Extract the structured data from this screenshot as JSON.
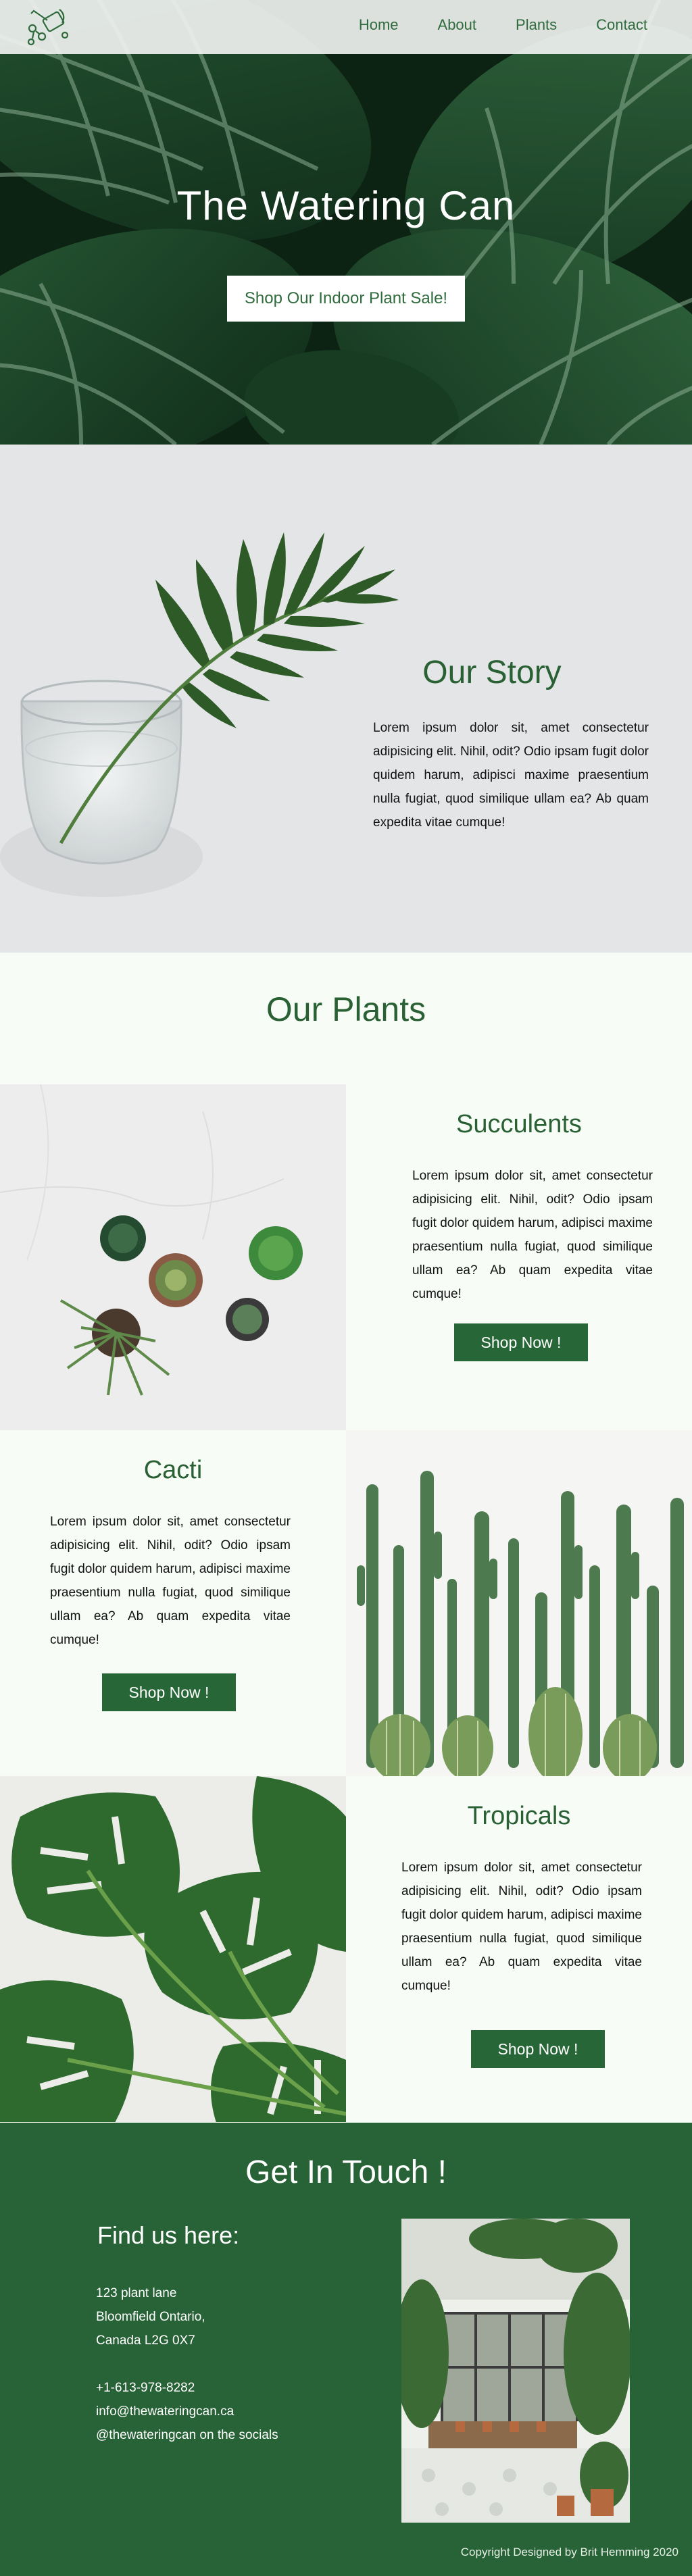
{
  "nav": {
    "logo_icon": "watering-can-icon",
    "links": [
      "Home",
      "About",
      "Plants",
      "Contact"
    ]
  },
  "hero": {
    "title": "The Watering Can",
    "button": "Shop Our Indoor Plant Sale!"
  },
  "story": {
    "title": "Our Story",
    "text": "Lorem ipsum dolor sit, amet consectetur adipisicing elit. Nihil, odit? Odio ipsam fugit dolor quidem harum, adipisci maxime praesentium nulla fugiat, quod similique ullam ea? Ab quam expedita vitae cumque!"
  },
  "plants": {
    "heading": "Our Plants",
    "items": [
      {
        "title": "Succulents",
        "text": "Lorem ipsum dolor sit, amet consectetur adipisicing elit. Nihil, odit? Odio ipsam fugit dolor quidem harum, adipisci maxime praesentium nulla fugiat, quod similique ullam ea? Ab quam expedita vitae cumque!",
        "button": "Shop Now !"
      },
      {
        "title": "Cacti",
        "text": "Lorem ipsum dolor sit, amet consectetur adipisicing elit. Nihil, odit? Odio ipsam fugit dolor quidem harum, adipisci maxime praesentium nulla fugiat, quod similique ullam ea? Ab quam expedita vitae cumque!",
        "button": "Shop Now !"
      },
      {
        "title": "Tropicals",
        "text": "Lorem ipsum dolor sit, amet consectetur adipisicing elit. Nihil, odit? Odio ipsam fugit dolor quidem harum, adipisci maxime praesentium nulla fugiat, quod similique ullam ea? Ab quam expedita vitae cumque!",
        "button": "Shop Now !"
      }
    ]
  },
  "contact": {
    "title": "Get In Touch !",
    "subtitle": "Find us here:",
    "address": [
      "123 plant lane",
      "Bloomfield Ontario,",
      "Canada L2G 0X7"
    ],
    "phone": "+1-613-978-8282",
    "email": "info@thewateringcan.ca",
    "social": "@thewateringcan on the socials"
  },
  "footer": {
    "copyright": "Copyright Designed by Brit Hemming 2020"
  },
  "colors": {
    "brand_green": "#276737",
    "heading_green": "#2a6134",
    "page_bg": "#f7fcf7"
  }
}
